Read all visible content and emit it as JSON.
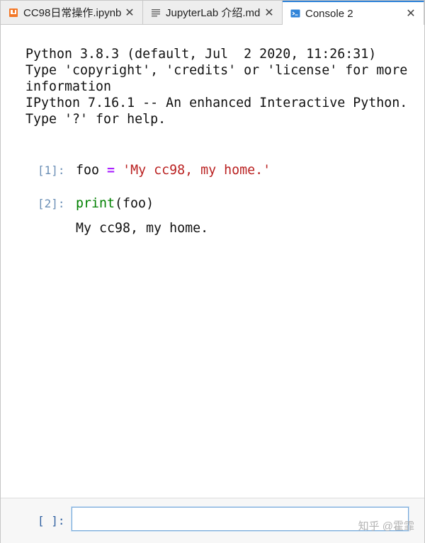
{
  "tabs": [
    {
      "label": "CC98日常操作.ipynb",
      "icon": "notebook-icon",
      "icon_color": "#f37726",
      "active": false
    },
    {
      "label": "JupyterLab 介绍.md",
      "icon": "markdown-file-icon",
      "icon_color": "#616161",
      "active": false
    },
    {
      "label": "Console 2",
      "icon": "console-icon",
      "icon_color": "#2f83d8",
      "active": true
    }
  ],
  "close_glyph": "✕",
  "console": {
    "banner": "Python 3.8.3 (default, Jul  2 2020, 11:26:31)\nType 'copyright', 'credits' or 'license' for more\ninformation\nIPython 7.16.1 -- An enhanced Interactive Python.\nType '?' for help.",
    "cells": [
      {
        "prompt": "[1]:",
        "tokens": [
          {
            "text": "foo ",
            "kind": "plain"
          },
          {
            "text": "=",
            "kind": "op"
          },
          {
            "text": " ",
            "kind": "plain"
          },
          {
            "text": "'My cc98, my home.'",
            "kind": "str"
          }
        ],
        "output": ""
      },
      {
        "prompt": "[2]:",
        "tokens": [
          {
            "text": "print",
            "kind": "builtin"
          },
          {
            "text": "(",
            "kind": "paren"
          },
          {
            "text": "foo",
            "kind": "plain"
          },
          {
            "text": ")",
            "kind": "paren"
          }
        ],
        "output": "My cc98, my home."
      }
    ]
  },
  "input": {
    "prompt": "[ ]:",
    "value": ""
  },
  "watermark": "知乎 @霍霏",
  "colors": {
    "accent": "#2f83d8",
    "prompt": "#6b8fb6",
    "string": "#ba2121",
    "operator": "#aa22ff",
    "builtin": "#008000"
  }
}
